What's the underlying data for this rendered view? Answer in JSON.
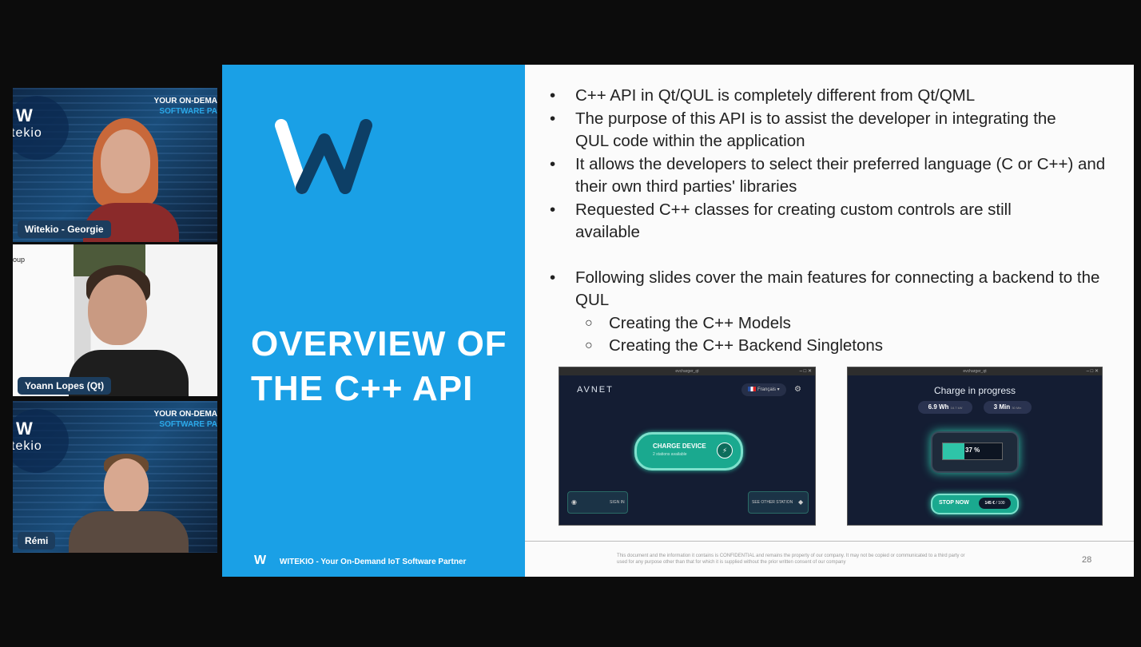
{
  "participants": [
    {
      "name": "Witekio - Georgie"
    },
    {
      "name": "Yoann Lopes (Qt)"
    },
    {
      "name": "Rémi"
    }
  ],
  "tile_brand": {
    "logo_top": "W",
    "logo_bottom": "tekio",
    "promo_line1": "YOUR ON-DEMA",
    "promo_line2": "SOFTWARE PA"
  },
  "tile2_fragment": "oup",
  "slide": {
    "title_line1": "OVERVIEW OF",
    "title_line2": "THE C++ API",
    "bullets": [
      "C++ API in Qt/QUL is completely different from Qt/QML",
      "The purpose of this API is to assist the developer in integrating the QUL code within the application",
      "It allows the developers to select their preferred language (C or C++) and their own third parties' libraries",
      "Requested C++ classes for creating custom controls are still available"
    ],
    "bullet5": "Following slides cover the main features for connecting a backend to the QUL",
    "sub_bullets": [
      "Creating the C++ Models",
      "Creating the C++ Backend Singletons"
    ],
    "footer_logo": "W",
    "footer_text": "WITEKIO - Your On-Demand IoT Software Partner",
    "confidential_text": "This document and the information it contains is CONFIDENTIAL and remains the property of our company. It may not be copied or communicated to a third party or used for any purpose other than that for which it is supplied without the prior written consent of our company",
    "page_number": "28"
  },
  "app1": {
    "window_title": "evcharger_qt",
    "brand": "AVNET",
    "language": "Français",
    "charge_button": "CHARGE DEVICE",
    "charge_sub": "2 stations available",
    "signin": "SIGN IN",
    "see_other": "SEE OTHER STATION"
  },
  "app2": {
    "window_title": "evcharger_qt",
    "title": "Charge in progress",
    "energy": "6.9 Wh",
    "energy_rate": "16.7 kW",
    "time": "3 Min",
    "time_left": "30 Min",
    "battery_percent": "37 %",
    "battery_level": 0.37,
    "stop_button": "STOP NOW",
    "price": "145 €",
    "price_unit": "/ 100"
  },
  "colors": {
    "slide_blue": "#1aa0e6",
    "app_bg": "#141d33",
    "accent_teal": "#2ec4a8"
  }
}
